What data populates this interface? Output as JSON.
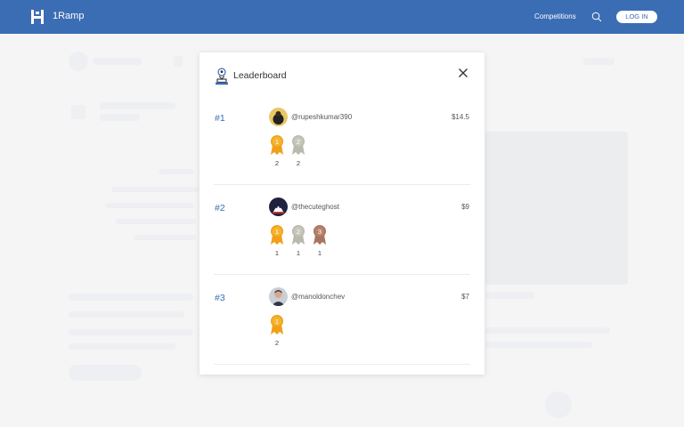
{
  "header": {
    "brand": "1Ramp",
    "nav_competitions": "Competitions",
    "login_label": "LOG IN"
  },
  "modal": {
    "title": "Leaderboard",
    "rows": [
      {
        "rank": "#1",
        "username": "@rupeshkumar390",
        "amount": "$14.5",
        "medals": [
          {
            "type": "gold",
            "label": "1",
            "count": "2"
          },
          {
            "type": "silver",
            "label": "2",
            "count": "2"
          }
        ]
      },
      {
        "rank": "#2",
        "username": "@thecuteghost",
        "amount": "$9",
        "medals": [
          {
            "type": "gold",
            "label": "1",
            "count": "1"
          },
          {
            "type": "silver",
            "label": "2",
            "count": "1"
          },
          {
            "type": "bronze",
            "label": "3",
            "count": "1"
          }
        ]
      },
      {
        "rank": "#3",
        "username": "@manoldonchev",
        "amount": "$7",
        "medals": [
          {
            "type": "gold",
            "label": "1",
            "count": "2"
          }
        ]
      }
    ]
  },
  "colors": {
    "header_bg": "#3b6db4",
    "rank": "#3b6db4",
    "gold": "#f0a018",
    "silver": "#b9b9ae",
    "bronze": "#a8745e"
  },
  "icons": {
    "logo": "1ramp-logo-icon",
    "search": "search-icon",
    "leaderboard": "trophy-user-icon",
    "close": "close-icon"
  }
}
